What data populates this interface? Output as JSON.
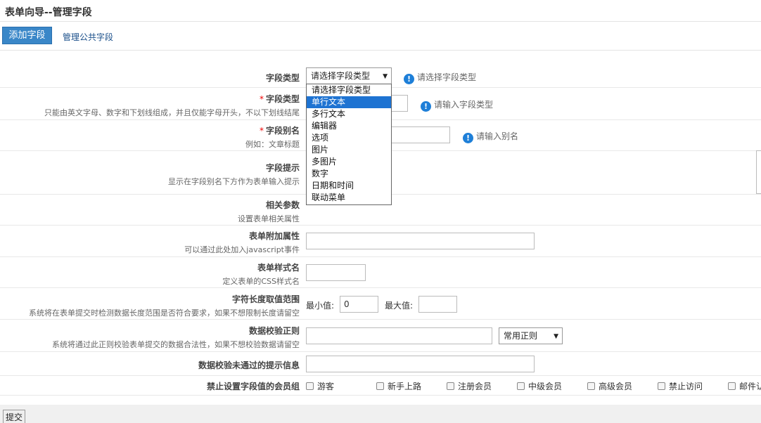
{
  "header": {
    "title": "表单向导--管理字段"
  },
  "tabs": [
    {
      "label": "添加字段",
      "active": true
    },
    {
      "label": "管理公共字段",
      "active": false
    }
  ],
  "fields": {
    "field_type": {
      "label": "字段类型",
      "selected": "请选择字段类型",
      "hint": "请选择字段类型",
      "options": [
        "请选择字段类型",
        "单行文本",
        "多行文本",
        "编辑器",
        "选项",
        "图片",
        "多图片",
        "数字",
        "日期和时间",
        "联动菜单"
      ],
      "highlighted_option": "单行文本"
    },
    "field_name": {
      "required_mark": "*",
      "label": "字段类型",
      "desc": "只能由英文字母、数字和下划线组成，并且仅能字母开头，不以下划线结尾",
      "hint": "请输入字段类型"
    },
    "field_alias": {
      "required_mark": "*",
      "label": "字段别名",
      "desc": "例如：文章标题",
      "hint": "请输入别名"
    },
    "field_tip": {
      "label": "字段提示",
      "desc": "显示在字段别名下方作为表单输入提示"
    },
    "params": {
      "label": "相关参数",
      "desc": "设置表单相关属性"
    },
    "extra_attr": {
      "label": "表单附加属性",
      "desc": "可以通过此处加入javascript事件"
    },
    "css_name": {
      "label": "表单样式名",
      "desc": "定义表单的CSS样式名"
    },
    "length_range": {
      "label": "字符长度取值范围",
      "desc": "系统将在表单提交时检测数据长度范围是否符合要求，如果不想限制长度请留空",
      "min_label": "最小值:",
      "min_value": "0",
      "max_label": "最大值:",
      "max_value": ""
    },
    "validation": {
      "label": "数据校验正则",
      "desc": "系统将通过此正则校验表单提交的数据合法性，如果不想校验数据请留空",
      "regex_select": "常用正则"
    },
    "validation_msg": {
      "label": "数据校验未通过的提示信息"
    },
    "banned_groups": {
      "label": "禁止设置字段值的会员组",
      "groups": [
        "游客",
        "新手上路",
        "注册会员",
        "中级会员",
        "高级会员",
        "禁止访问",
        "邮件认"
      ]
    }
  },
  "footer": {
    "submit_label": "提交"
  },
  "colors": {
    "tab_active_bg": "#3a87c8",
    "selected_option_bg": "#1e73d2",
    "hint_icon": "#1e7fd8",
    "required": "#ee0000"
  },
  "icons": {
    "hint": "exclamation-circle-icon"
  }
}
